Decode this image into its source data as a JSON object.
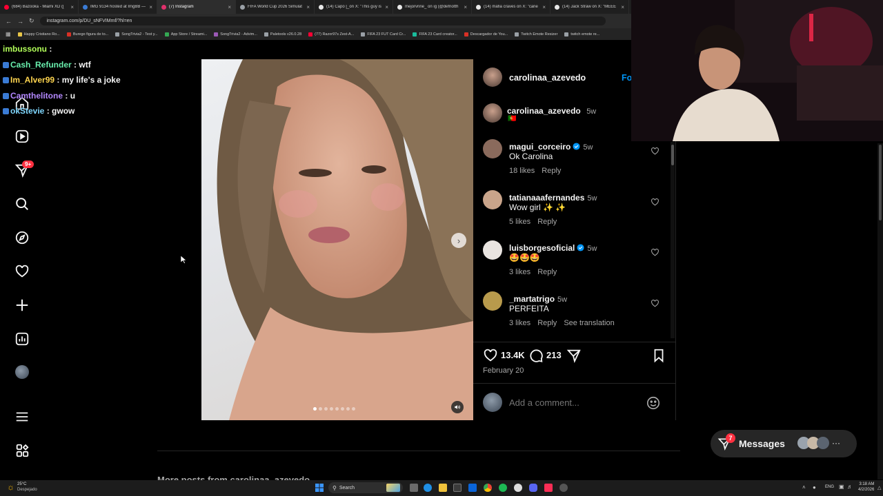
{
  "browser": {
    "tabs": [
      {
        "title": "(684) Bazooka - Miami XD ([",
        "color": "#ff0033"
      },
      {
        "title": "IMG 9134 hosted at ImgBB —",
        "color": "#3a7bd5"
      },
      {
        "title": "(7) Instagram",
        "color": "#e1306c"
      },
      {
        "title": "FIFA World Cup 2026 Simulat",
        "color": "#9aa0a6"
      },
      {
        "title": "(14) Capo [_on X: \"This guy is",
        "color": "#e8e8e8"
      },
      {
        "title": "mejorvnne_ on ig (@defnotth",
        "color": "#e8e8e8"
      },
      {
        "title": "(14) mafia craves on X: \"cane",
        "color": "#e8e8e8"
      },
      {
        "title": "(14) Jack Straw on X: \"MEEE",
        "color": "#e8e8e8"
      }
    ],
    "url": "instagram.com/p/DU_sNFVIMmf/?hl=en",
    "bookmarks": [
      {
        "label": "Happy Cristiano Ro...",
        "color": "#e8c547"
      },
      {
        "label": "Burego figura de to...",
        "color": "#d93025"
      },
      {
        "label": "SongTrivia2 - Test y...",
        "color": "#9aa0a6"
      },
      {
        "label": "App Store / Streami...",
        "color": "#34a853"
      },
      {
        "label": "SongTrivia2 - Advim...",
        "color": "#9b59b6"
      },
      {
        "label": "Paletools v26.0.28",
        "color": "#9aa0a6"
      },
      {
        "label": "(77) Razor97s Zest-A...",
        "color": "#ff0033"
      },
      {
        "label": "FIFA 23 FUT Card Cr...",
        "color": "#9aa0a6"
      },
      {
        "label": "FIFA 23 Card creator...",
        "color": "#1abc9c"
      },
      {
        "label": "Descargador de You...",
        "color": "#d93025"
      },
      {
        "label": "Twitch Emote Resizer",
        "color": "#9aa0a6"
      },
      {
        "label": "twitch emote re...",
        "color": "#9aa0a6"
      }
    ]
  },
  "chat": [
    {
      "user": "imbussonu",
      "msg": "",
      "color": "#b2ff59"
    },
    {
      "user": "Cash_Refunder",
      "msg": "wtf",
      "color": "#69f0ae"
    },
    {
      "user": "Im_Alver99",
      "msg": "my life's a joke",
      "color": "#ffd54f"
    },
    {
      "user": "Camthelitone",
      "msg": "u",
      "color": "#b388ff"
    },
    {
      "user": "okStevie",
      "msg": "gwow",
      "color": "#80d8ff"
    }
  ],
  "ig_nav": {
    "notifications_badge": "9+"
  },
  "post": {
    "author": "carolinaa_azevedo",
    "follow_label": "Fo",
    "caption_time": "5w",
    "caption_text": "🇵🇹",
    "likes": "13.4K",
    "comments": "213",
    "date": "February 20",
    "add_comment_placeholder": "Add a comment...",
    "image_dots": 8
  },
  "comments": [
    {
      "user": "magui_corceiro",
      "verified": true,
      "time": "5w",
      "text": "Ok Carolina",
      "likes": "18 likes",
      "reply": "Reply",
      "translate": "",
      "avatar": "#8a6a5c"
    },
    {
      "user": "tatianaaafernandes",
      "verified": false,
      "time": "5w",
      "text": "Wow girl ✨ ✨",
      "likes": "5 likes",
      "reply": "Reply",
      "translate": "",
      "avatar": "#c9a48a"
    },
    {
      "user": "luisborgesoficial",
      "verified": true,
      "time": "5w",
      "text": "🤩🤩🤩",
      "likes": "3 likes",
      "reply": "Reply",
      "translate": "",
      "avatar": "#e9e4e0"
    },
    {
      "user": "_martatrigo",
      "verified": false,
      "time": "5w",
      "text": "PERFEITA",
      "likes": "3 likes",
      "reply": "Reply",
      "translate": "See translation",
      "avatar": "#b89a4c"
    }
  ],
  "messages": {
    "label": "Messages",
    "badge": "7"
  },
  "more_posts": "More posts from carolinaa_azevedo",
  "taskbar": {
    "weather_temp": "25°C",
    "weather_text": "Despejado",
    "search": "Search",
    "lang": "ENG",
    "time": "3:18 AM",
    "date": "4/2/2026"
  },
  "colors": {
    "accent": "#0095f6",
    "panel_border": "#262626",
    "notif_red": "#ff3040"
  }
}
